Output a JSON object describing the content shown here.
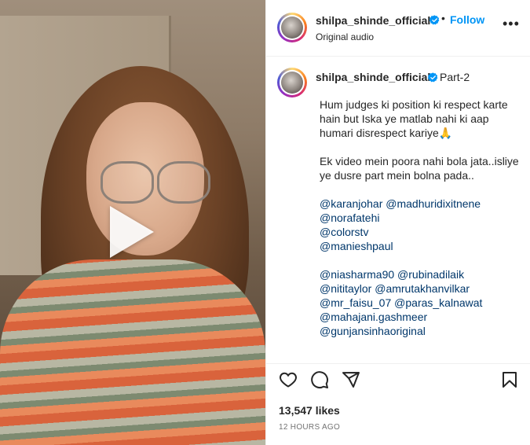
{
  "header": {
    "username": "shilpa_shinde_official",
    "separator": "•",
    "follow_label": "Follow",
    "subtitle": "Original audio",
    "more_label": "•••"
  },
  "caption": {
    "username": "shilpa_shinde_official",
    "tag": "Part-2",
    "paragraph1": "Hum judges ki position ki respect karte hain but Iska ye matlab nahi ki aap humari disrespect kariye🙏",
    "paragraph2": "Ek video mein poora nahi bola jata..isliye ye dusre part mein bolna pada..",
    "mentions_group1": [
      "@karanjohar",
      "@madhuridixitnene",
      "@norafatehi",
      "@colorstv",
      "@manieshpaul"
    ],
    "mentions_group2": [
      "@niasharma90",
      "@rubinadilaik",
      "@nititaylor",
      "@amrutakhanvilkar",
      "@mr_faisu_07",
      "@paras_kalnawat",
      "@mahajani.gashmeer",
      "@gunjansinhaoriginal"
    ]
  },
  "stats": {
    "likes": "13,547 likes",
    "time": "12 HOURS AGO"
  },
  "icons": {
    "like": "heart-icon",
    "comment": "comment-icon",
    "share": "share-icon",
    "save": "bookmark-icon",
    "verified": "verified-badge-icon",
    "play": "play-icon"
  },
  "colors": {
    "follow": "#0095f6",
    "mention": "#00376b",
    "verified": "#0095f6",
    "muted": "#737373"
  }
}
